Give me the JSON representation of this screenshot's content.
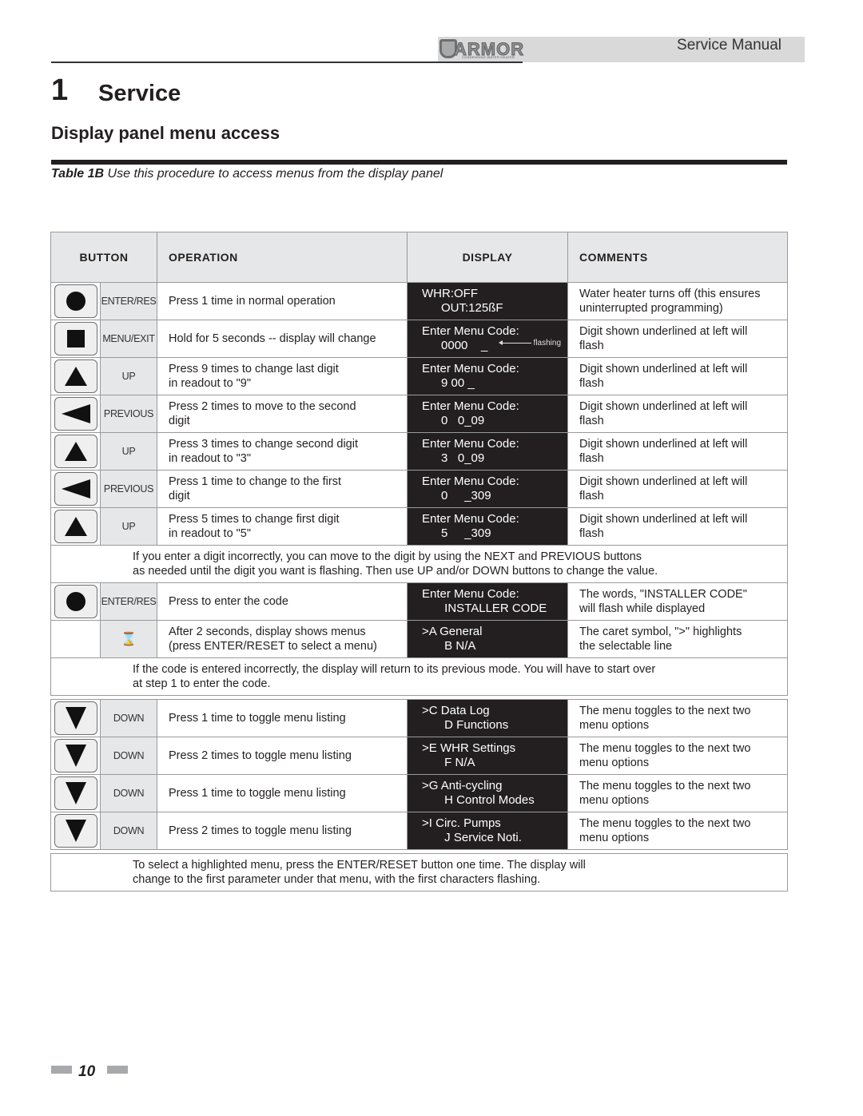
{
  "header": {
    "brand": "ARMOR",
    "brand_tagline": "CONDENSING WATER HEATER",
    "manual_title": "Service Manual"
  },
  "chapter": {
    "number": "1",
    "title": "Service"
  },
  "section_title": "Display panel menu access",
  "caption": {
    "label": "Table 1B",
    "text": " Use this procedure to access menus from the display panel"
  },
  "table": {
    "headers": {
      "button": "BUTTON",
      "operation": "OPERATION",
      "display": "DISPLAY",
      "comments": "COMMENTS"
    },
    "rows": [
      {
        "icon": "circle",
        "label": "ENTER/RES",
        "operation": [
          "Press 1 time in normal operation"
        ],
        "display": [
          "WHR:OFF",
          "OUT:125ßF"
        ],
        "comments": [
          "Water heater turns off (this ensures",
          "uninterrupted programming)"
        ]
      },
      {
        "icon": "square",
        "label": "MENU/EXIT",
        "operation": [
          "Hold for 5 seconds -- display will change"
        ],
        "display": [
          "Enter Menu Code:",
          "0000    _"
        ],
        "display_note": "flashing",
        "comments": [
          "Digit shown underlined at left will",
          "flash"
        ]
      },
      {
        "icon": "up",
        "label": "UP",
        "operation": [
          "Press 9 times to change last digit",
          "in readout to \"9\""
        ],
        "display": [
          "Enter Menu Code:",
          "9 00 _"
        ],
        "comments": [
          "Digit shown underlined at left will",
          "flash"
        ]
      },
      {
        "icon": "left",
        "label": "PREVIOUS",
        "operation": [
          "Press 2 times to move to the second",
          "digit"
        ],
        "display": [
          "Enter Menu Code:",
          "0   0_09"
        ],
        "comments": [
          "Digit shown underlined at left will",
          "flash"
        ]
      },
      {
        "icon": "up",
        "label": "UP",
        "operation": [
          "Press 3 times to change second digit",
          "in readout to \"3\""
        ],
        "display": [
          "Enter Menu Code:",
          "3   0_09"
        ],
        "comments": [
          "Digit shown underlined at left will",
          "flash"
        ]
      },
      {
        "icon": "left",
        "label": "PREVIOUS",
        "operation": [
          "Press 1 time to change to the first",
          "digit"
        ],
        "display": [
          "Enter Menu Code:",
          "0     _309"
        ],
        "comments": [
          "Digit shown underlined at left will",
          "flash"
        ]
      },
      {
        "icon": "up",
        "label": "UP",
        "operation": [
          "Press 5 times to change first digit",
          "in readout to \"5\""
        ],
        "display": [
          "Enter Menu Code:",
          "5     _309"
        ],
        "comments": [
          "Digit shown underlined at left will",
          "flash"
        ]
      }
    ],
    "note1": [
      "If you enter a digit incorrectly, you can move to the digit by using the NEXT and PREVIOUS buttons",
      "as needed until the digit you want is flashing. Then use UP and/or DOWN buttons to change the value."
    ],
    "rows2": [
      {
        "icon": "circle",
        "label": "ENTER/RES",
        "operation": [
          "Press to enter the code"
        ],
        "display": [
          "Enter Menu Code:",
          " INSTALLER CODE"
        ],
        "comments": [
          "The words, \"INSTALLER CODE\"",
          "will flash while displayed"
        ]
      },
      {
        "icon": "hourglass",
        "label": "",
        "operation": [
          "After 2 seconds, display shows menus",
          "(press ENTER/RESET to select a menu)"
        ],
        "display": [
          ">A General",
          " B N/A"
        ],
        "comments": [
          "The caret symbol, \">\" highlights",
          "the selectable line"
        ]
      }
    ],
    "note2": [
      "If the code is entered incorrectly, the display will return to its previous mode. You will have to start over",
      "at step 1 to enter the code."
    ],
    "rows3": [
      {
        "icon": "down",
        "label": "DOWN",
        "operation": [
          "Press 1 time to toggle menu listing"
        ],
        "display": [
          ">C Data Log",
          " D Functions"
        ],
        "comments": [
          "The menu toggles to the next two",
          "menu options"
        ]
      },
      {
        "icon": "down",
        "label": "DOWN",
        "operation": [
          "Press 2 times to toggle menu listing"
        ],
        "display": [
          ">E WHR Settings",
          " F N/A"
        ],
        "comments": [
          "The menu toggles to the next two",
          "menu options"
        ]
      },
      {
        "icon": "down",
        "label": "DOWN",
        "operation": [
          "Press 1 time to toggle menu listing"
        ],
        "display": [
          ">G Anti-cycling",
          " H Control Modes"
        ],
        "comments": [
          "The menu toggles to the next two",
          "menu options"
        ]
      },
      {
        "icon": "down",
        "label": "DOWN",
        "operation": [
          "Press 2 times to toggle menu listing"
        ],
        "display": [
          ">I Circ. Pumps",
          " J Service Noti."
        ],
        "comments": [
          "The menu toggles to the next two",
          "menu options"
        ]
      }
    ],
    "note3": [
      "To select a highlighted menu, press the ENTER/RESET button one time. The display will",
      "change to the first parameter under that menu, with the first characters flashing."
    ]
  },
  "footer": {
    "page_number": "10"
  }
}
